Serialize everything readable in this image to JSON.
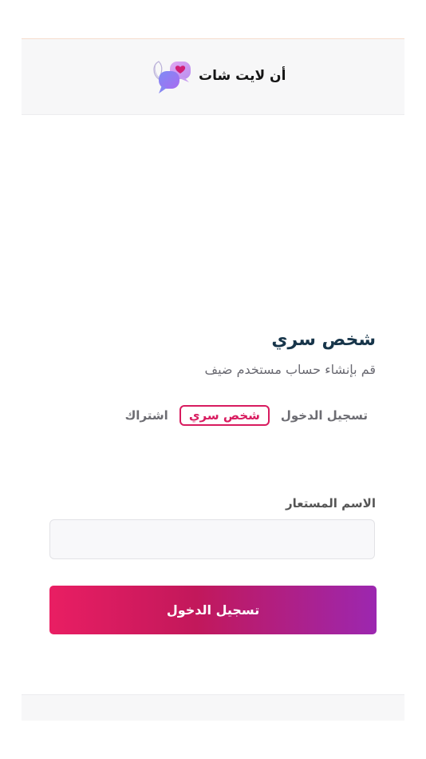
{
  "header": {
    "brand_name": "أن لايت شات",
    "logo_icon": "chat-bubbles-heart-logo"
  },
  "form": {
    "title": "شخص سري",
    "subtitle": "قم بإنشاء حساب مستخدم ضيف",
    "tabs": [
      {
        "label": "تسجيل الدخول",
        "active": false
      },
      {
        "label": "شخص سري",
        "active": true
      },
      {
        "label": "اشتراك",
        "active": false
      }
    ],
    "nickname_label": "الاسم المستعار",
    "nickname_value": "",
    "submit_label": "تسجيل الدخول"
  },
  "colors": {
    "accent": "#d81b5f",
    "gradient_start": "#e91e63",
    "gradient_end": "#9c27b0",
    "title": "#17354a"
  }
}
